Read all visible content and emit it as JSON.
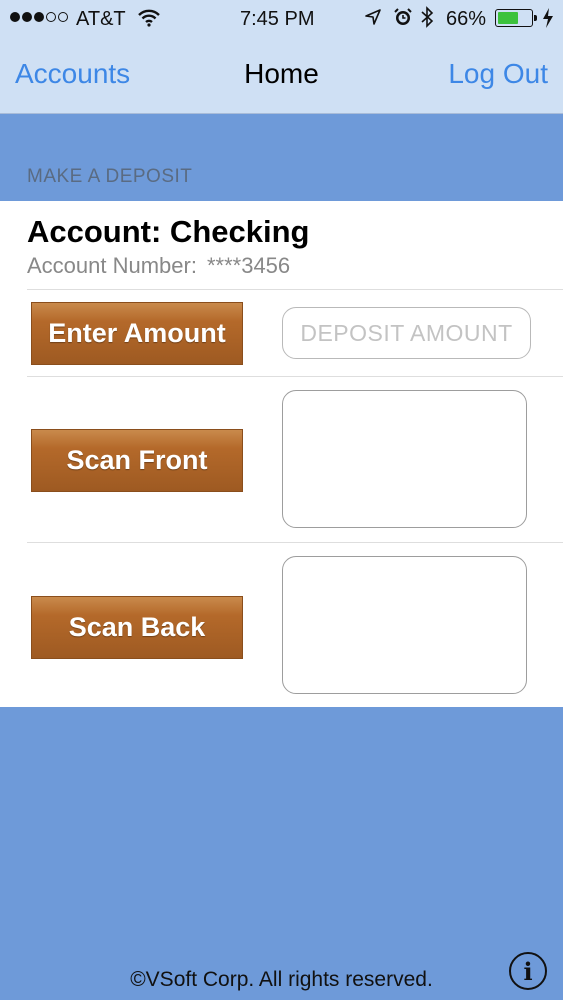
{
  "status_bar": {
    "carrier": "AT&T",
    "time": "7:45 PM",
    "battery_percent": "66%",
    "battery_level": 0.66,
    "icons": [
      "signal-dots",
      "wifi-icon",
      "location-arrow-icon",
      "alarm-icon",
      "bluetooth-icon",
      "battery-icon",
      "charging-icon"
    ]
  },
  "nav": {
    "left": "Accounts",
    "title": "Home",
    "right": "Log Out"
  },
  "section_header": "MAKE A DEPOSIT",
  "account": {
    "title": "Account: Checking",
    "number_label": "Account Number:",
    "number_masked": "****3456"
  },
  "actions": {
    "enter_amount": "Enter Amount",
    "amount_placeholder": "DEPOSIT AMOUNT",
    "scan_front": "Scan Front",
    "scan_back": "Scan Back"
  },
  "footer": {
    "copyright": "©VSoft Corp. All rights reserved.",
    "info_icon": "i"
  },
  "colors": {
    "nav_bg": "#cfe0f4",
    "link_blue": "#3d87e6",
    "page_bg": "#6e9ad9",
    "button_brown": "#b4692a"
  }
}
